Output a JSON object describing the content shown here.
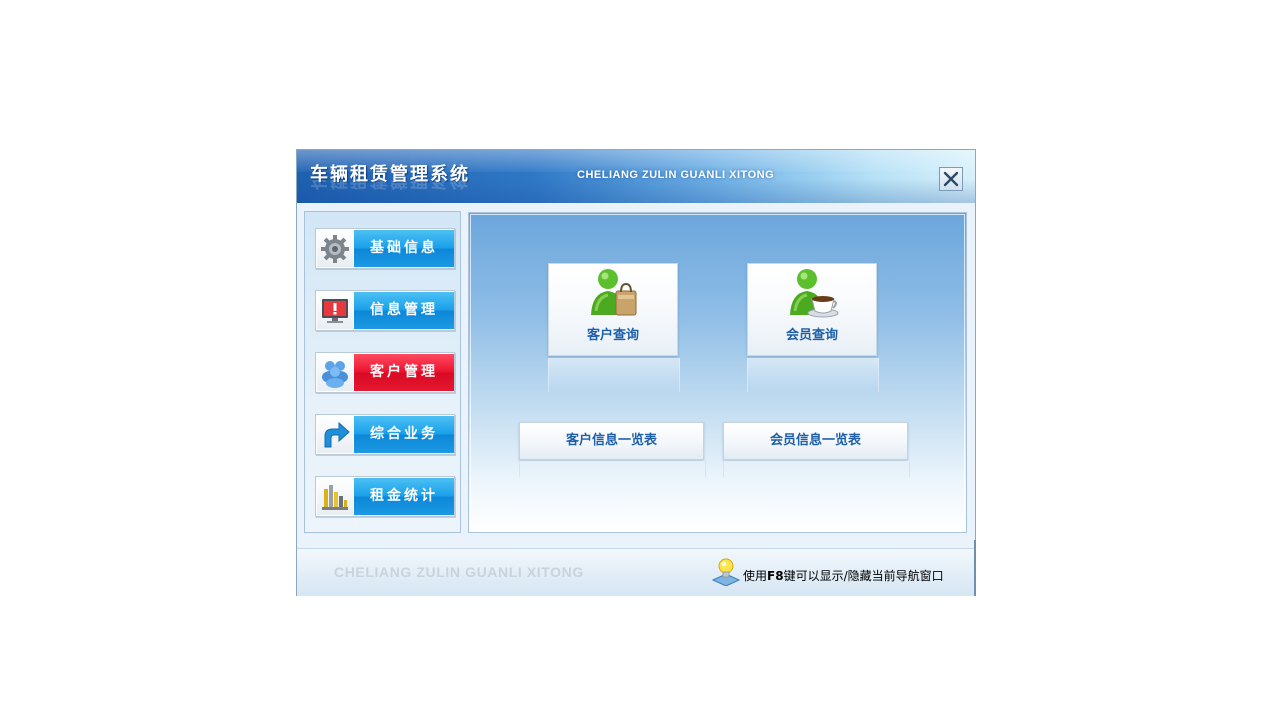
{
  "window": {
    "title": "车辆租赁管理系统",
    "subtitle": "CHELIANG ZULIN GUANLI XITONG",
    "close_icon": "close-icon"
  },
  "nav": {
    "items": [
      {
        "label": "基础信息",
        "icon": "gear-icon",
        "active": false
      },
      {
        "label": "信息管理",
        "icon": "monitor-alert-icon",
        "active": false
      },
      {
        "label": "客户管理",
        "icon": "users-icon",
        "active": true
      },
      {
        "label": "综合业务",
        "icon": "arrow-turn-icon",
        "active": false
      },
      {
        "label": "租金统计",
        "icon": "bar-chart-icon",
        "active": false
      }
    ]
  },
  "main": {
    "tiles": [
      {
        "label": "客户查询",
        "icon": "user-shopping-bag-icon"
      },
      {
        "label": "会员查询",
        "icon": "user-coffee-cup-icon"
      }
    ],
    "list_buttons": [
      {
        "label": "客户信息一览表"
      },
      {
        "label": "会员信息一览表"
      }
    ]
  },
  "footer": {
    "brand": "CHELIANG ZULIN GUANLI XITONG",
    "hint_prefix": "使用",
    "hint_key": "F8",
    "hint_suffix": "键可以显示/隐藏当前导航窗口",
    "hint_icon": "lightbulb-icon"
  },
  "colors": {
    "title_gradient_start": "#1e5fb0",
    "nav_blue": "#1aa0e9",
    "nav_active_red": "#ec1330",
    "tile_text": "#1d5fa8"
  }
}
